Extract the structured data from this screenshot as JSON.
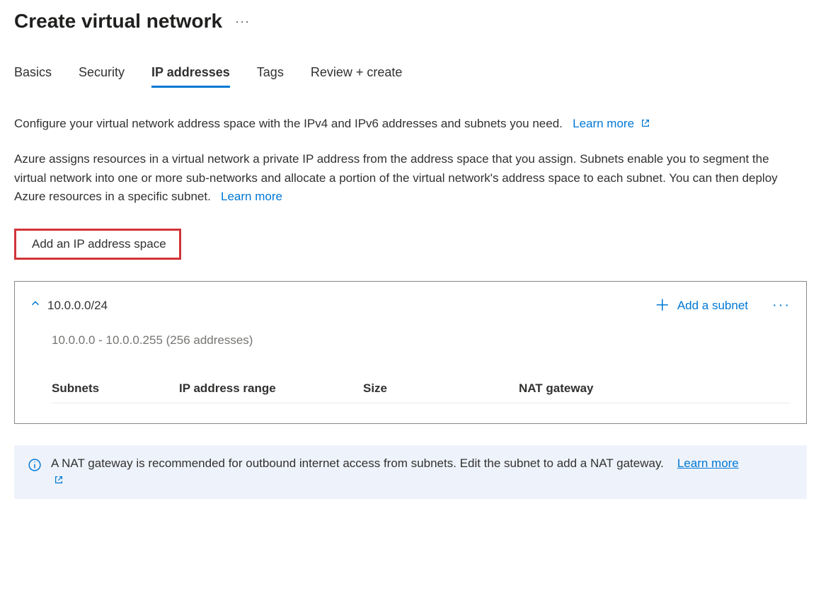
{
  "header": {
    "title": "Create virtual network"
  },
  "tabs": [
    {
      "label": "Basics",
      "active": false
    },
    {
      "label": "Security",
      "active": false
    },
    {
      "label": "IP addresses",
      "active": true
    },
    {
      "label": "Tags",
      "active": false
    },
    {
      "label": "Review + create",
      "active": false
    }
  ],
  "descriptions": {
    "p1": "Configure your virtual network address space with the IPv4 and IPv6 addresses and subnets you need.",
    "p1_link": "Learn more",
    "p2": "Azure assigns resources in a virtual network a private IP address from the address space that you assign. Subnets enable you to segment the virtual network into one or more sub-networks and allocate a portion of the virtual network's address space to each subnet. You can then deploy Azure resources in a specific subnet.",
    "p2_link": "Learn more"
  },
  "add_space_button": "Add an IP address space",
  "ip_space": {
    "cidr": "10.0.0.0/24",
    "range_text": "10.0.0.0 - 10.0.0.255 (256 addresses)",
    "add_subnet_label": "Add a subnet",
    "columns": {
      "subnets": "Subnets",
      "range": "IP address range",
      "size": "Size",
      "nat": "NAT gateway"
    }
  },
  "info_banner": {
    "text": "A NAT gateway is recommended for outbound internet access from subnets. Edit the subnet to add a NAT gateway.",
    "link": "Learn more"
  }
}
